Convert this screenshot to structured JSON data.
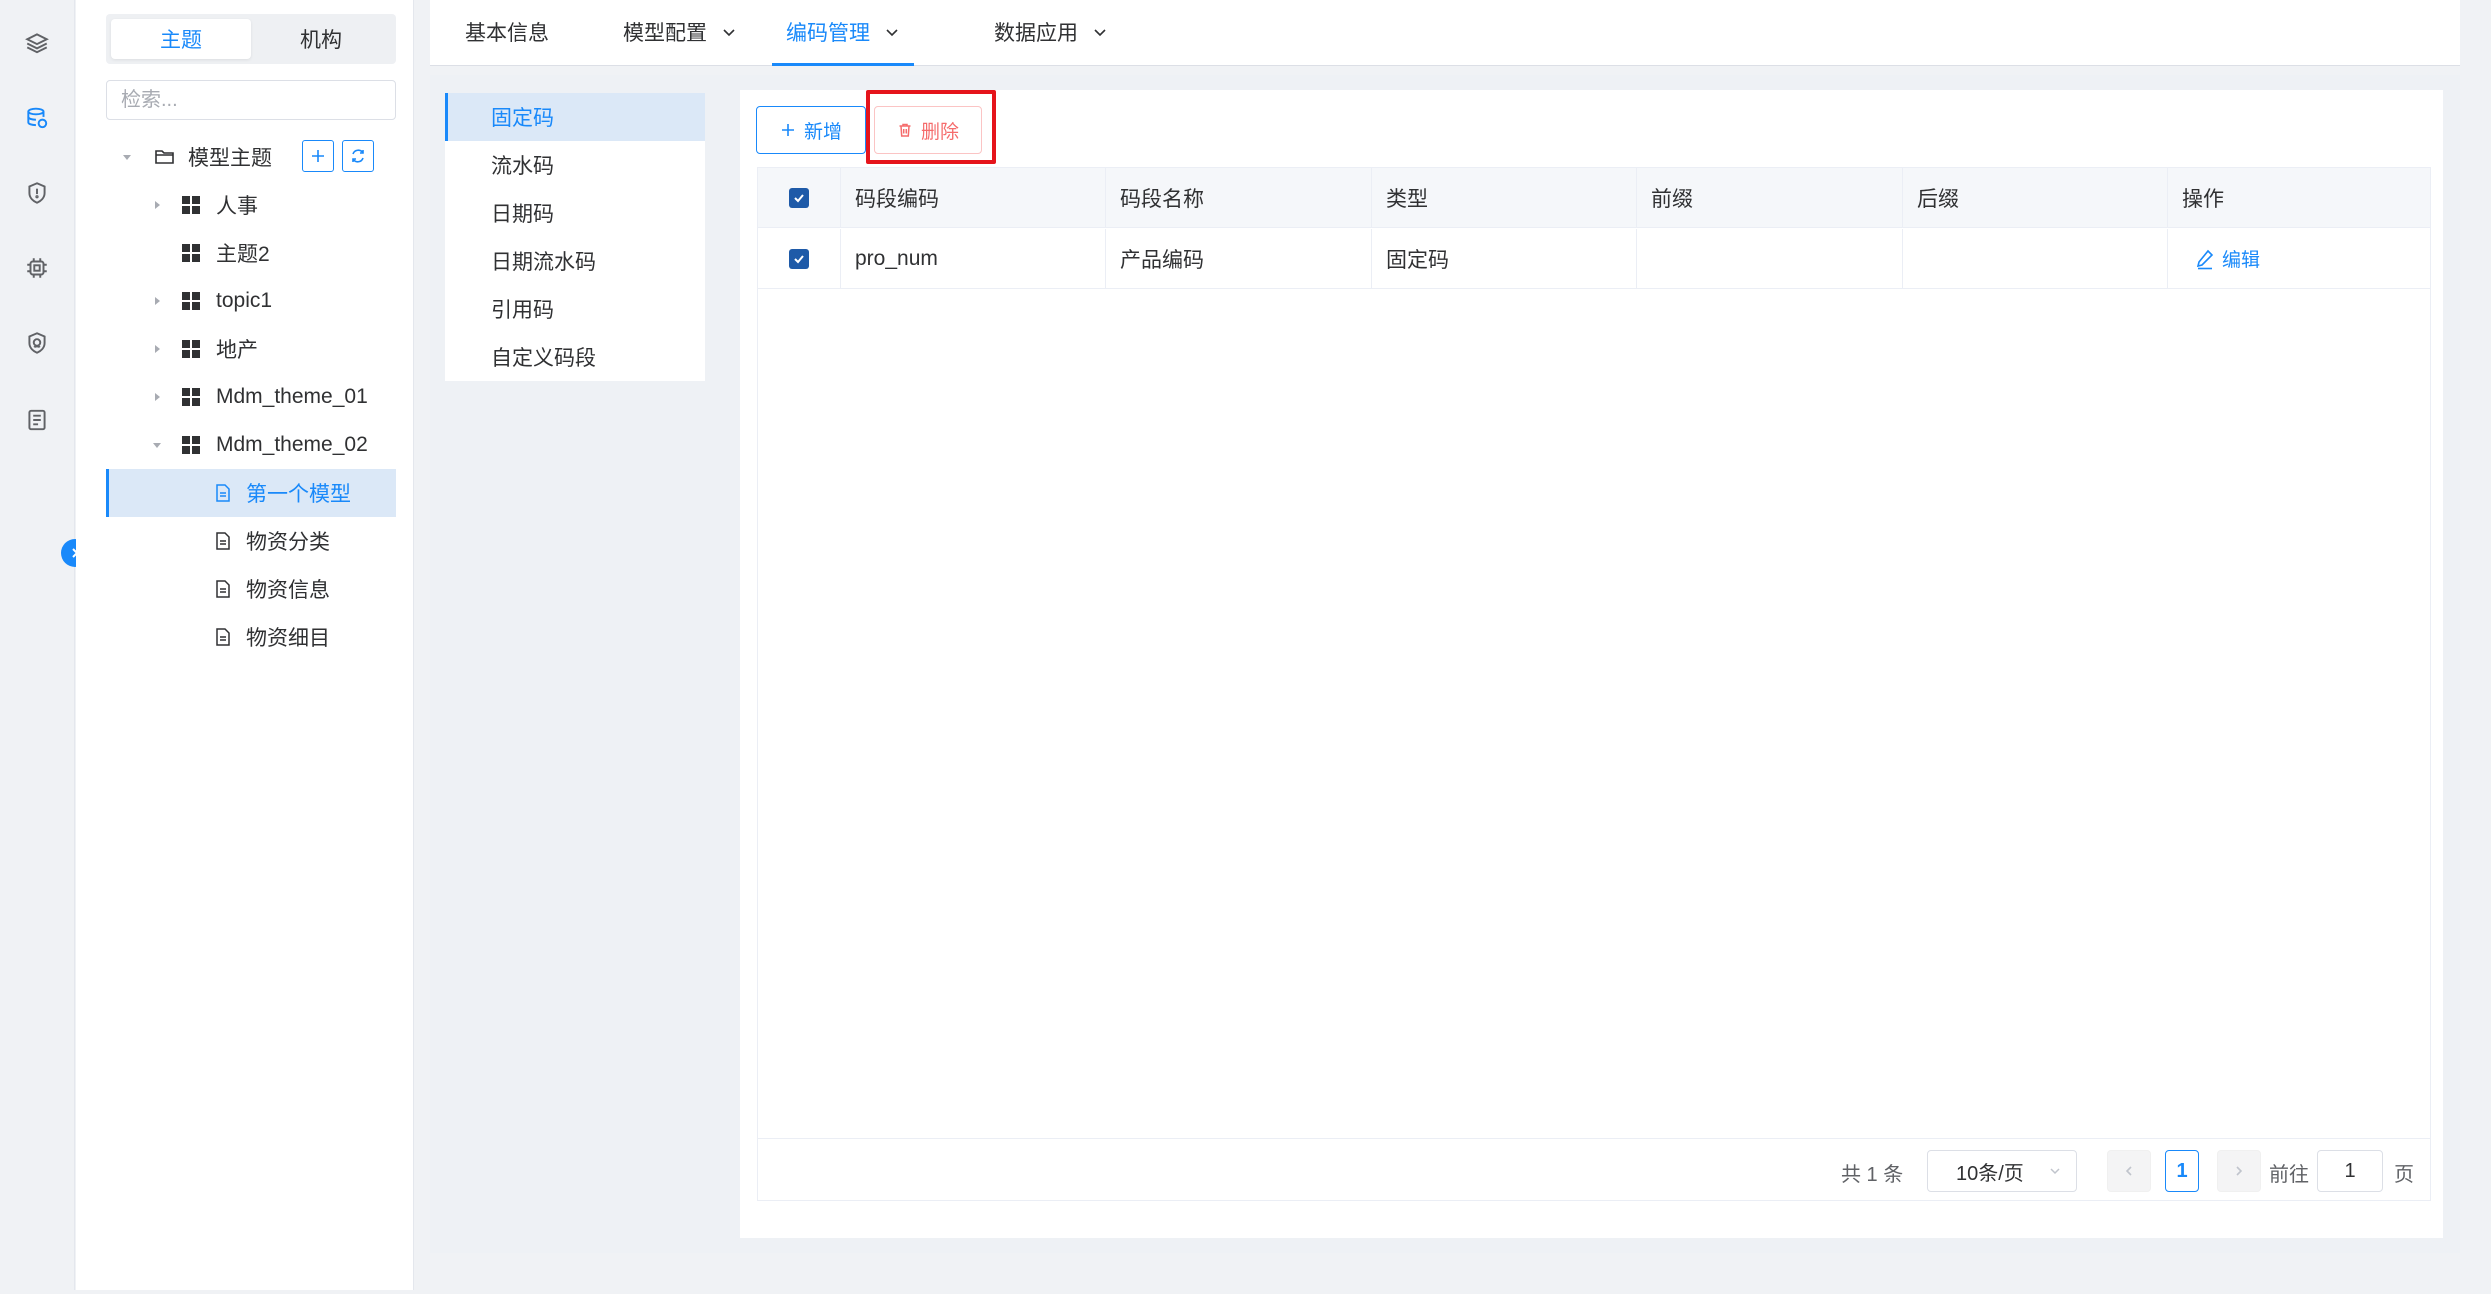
{
  "rail": {
    "icons": [
      "layers-icon",
      "database-icon",
      "shield-icon",
      "chip-icon",
      "security-icon",
      "document-list-icon"
    ]
  },
  "tree_panel": {
    "segment_tabs": [
      "主题",
      "机构"
    ],
    "search_placeholder": "检索...",
    "root_label": "模型主题",
    "items": [
      {
        "label": "人事"
      },
      {
        "label": "主题2"
      },
      {
        "label": "topic1"
      },
      {
        "label": "地产"
      },
      {
        "label": "Mdm_theme_01"
      },
      {
        "label": "Mdm_theme_02"
      }
    ],
    "children": [
      {
        "label": "第一个模型"
      },
      {
        "label": "物资分类"
      },
      {
        "label": "物资信息"
      },
      {
        "label": "物资细目"
      }
    ]
  },
  "tabs": [
    {
      "label": "基本信息"
    },
    {
      "label": "模型配置"
    },
    {
      "label": "编码管理"
    },
    {
      "label": "数据应用"
    }
  ],
  "segment_menu": [
    "固定码",
    "流水码",
    "日期码",
    "日期流水码",
    "引用码",
    "自定义码段"
  ],
  "toolbar": {
    "add_label": "新增",
    "delete_label": "删除"
  },
  "table": {
    "columns": [
      "码段编码",
      "码段名称",
      "类型",
      "前缀",
      "后缀",
      "操作"
    ],
    "rows": [
      {
        "code": "pro_num",
        "name": "产品编码",
        "type": "固定码",
        "prefix": "",
        "suffix": "",
        "action": "编辑"
      }
    ]
  },
  "pagination": {
    "total_text": "共 1 条",
    "page_size": "10条/页",
    "current_page": "1",
    "goto_label": "前往",
    "goto_value": "1",
    "page_suffix": "页"
  },
  "colors": {
    "primary": "#1989fa",
    "danger": "#f56c6c",
    "highlight": "#e5141b"
  }
}
